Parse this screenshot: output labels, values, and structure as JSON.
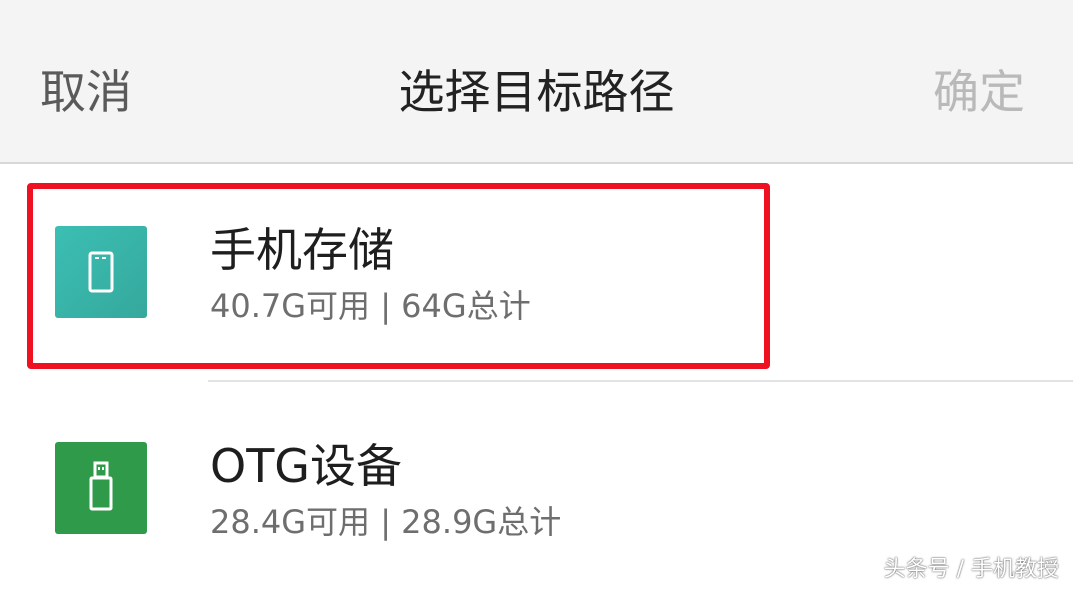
{
  "header": {
    "cancel_label": "取消",
    "title": "选择目标路径",
    "confirm_label": "确定"
  },
  "storage": [
    {
      "name": "手机存储",
      "summary": "40.7G可用 | 64G总计",
      "icon": "phone-icon",
      "color": "#3cbfb4"
    },
    {
      "name": "OTG设备",
      "summary": "28.4G可用 | 28.9G总计",
      "icon": "usb-drive-icon",
      "color": "#2f9a4a"
    }
  ],
  "watermark": "头条号 / 手机教授",
  "colors": {
    "highlight": "#ee1122",
    "header_bg": "#f4f4f4"
  }
}
